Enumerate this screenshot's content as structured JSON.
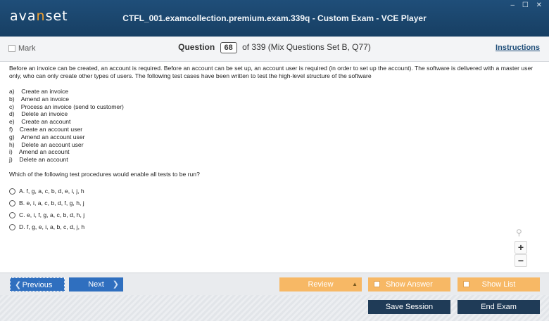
{
  "app": {
    "logo_prefix": "ava",
    "logo_accent": "n",
    "logo_suffix": "set",
    "window_title": "CTFL_001.examcollection.premium.exam.339q - Custom Exam - VCE Player",
    "window_controls": "‒ ☐ ✕"
  },
  "question_bar": {
    "mark_label": "Mark",
    "question_label": "Question",
    "question_number": "68",
    "of_text": "of 339 (Mix Questions Set B, Q77)",
    "instructions_label": "Instructions"
  },
  "question": {
    "stem": "Before an invoice can be created, an account is required. Before an account can be set up, an account user is required (in order to set up the account). The software is delivered with a master user only, who can only create other types of users. The following test cases have been written to test the high-level structure of the software",
    "items": [
      "a)    Create an invoice",
      "b)    Amend an invoice",
      "c)    Process an invoice (send to customer)",
      "d)    Delete an invoice",
      "e)    Create an account",
      "f)    Create an account user",
      "g)    Amend an account user",
      "h)    Delete an account user",
      "i)    Amend an account",
      "j)    Delete an account"
    ],
    "prompt": "Which of the following test procedures would enable all tests to be run?",
    "options": [
      "A.  f, g, a, c, b, d, e, i, j, h",
      "B.  e, i, a, c, b, d, f, g, h, j",
      "C.  e, i, f, g, a, c, b, d, h, j",
      "D.  f, g, e, i, a, b, c, d, j, h"
    ]
  },
  "tools": {
    "search_icon": "⚲",
    "zoom_in": "+",
    "zoom_out": "−"
  },
  "footer": {
    "previous": "Previous",
    "next": "Next",
    "review": "Review",
    "show_answer": "Show Answer",
    "show_list": "Show List",
    "save_session": "Save Session",
    "end_exam": "End Exam"
  },
  "colors": {
    "titlebar": "#1f4e79",
    "nav_button": "#2f6fbf",
    "orange_button": "#f7b865",
    "dark_button": "#1f3b57",
    "logo_accent": "#f0a030"
  }
}
